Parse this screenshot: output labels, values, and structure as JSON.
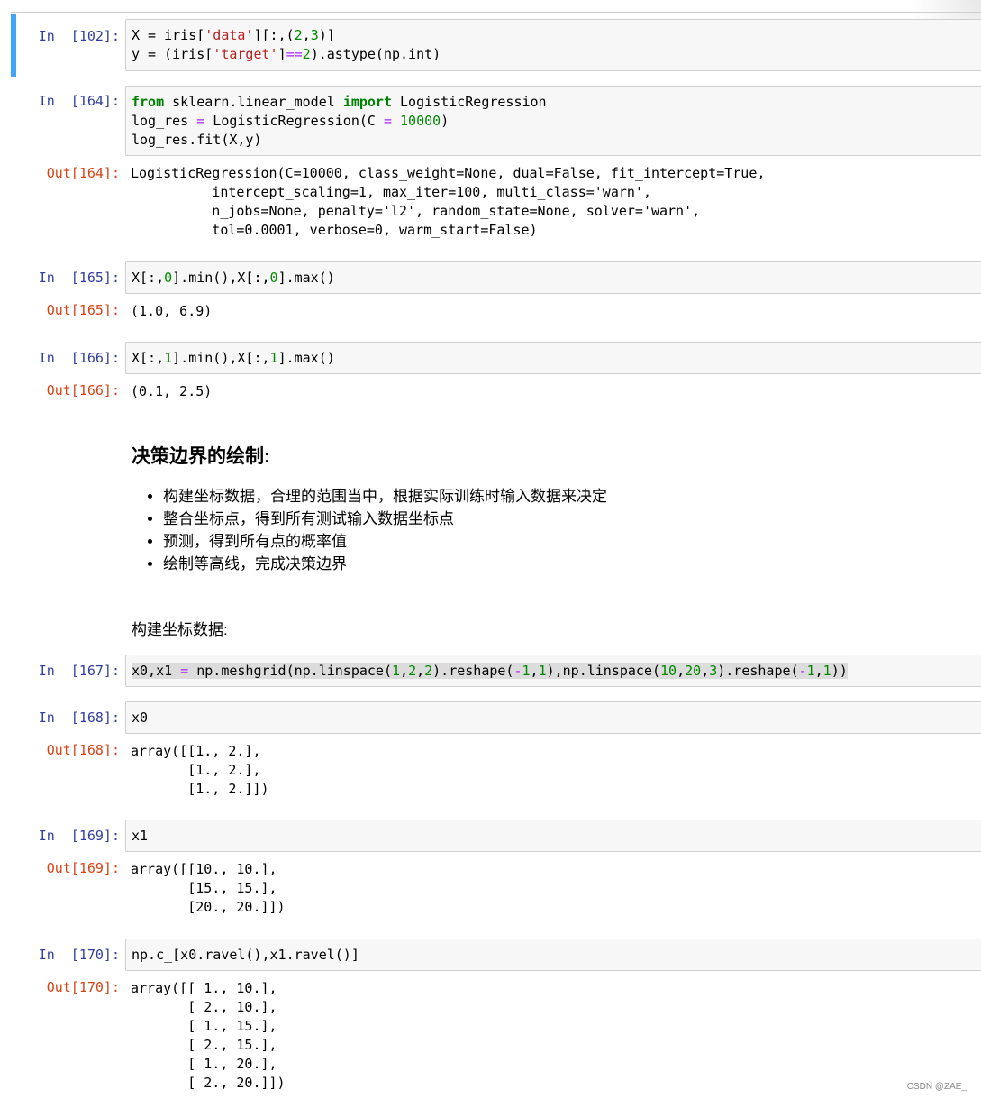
{
  "cells": [
    {
      "id": "c102",
      "in": "In  [102]:",
      "code": [
        "X = iris['data'][:,(2,3)]",
        "y = (iris['target']==2).astype(np.int)"
      ]
    },
    {
      "id": "c164",
      "in": "In  [164]:",
      "code": [
        "from sklearn.linear_model import LogisticRegression",
        "log_res = LogisticRegression(C = 10000)",
        "log_res.fit(X,y)"
      ],
      "out": "Out[164]:",
      "output": [
        "LogisticRegression(C=10000, class_weight=None, dual=False, fit_intercept=True,",
        "          intercept_scaling=1, max_iter=100, multi_class='warn',",
        "          n_jobs=None, penalty='l2', random_state=None, solver='warn',",
        "          tol=0.0001, verbose=0, warm_start=False)"
      ]
    },
    {
      "id": "c165",
      "in": "In  [165]:",
      "code": [
        "X[:,0].min(),X[:,0].max()"
      ],
      "out": "Out[165]:",
      "output": [
        "(1.0, 6.9)"
      ]
    },
    {
      "id": "c166",
      "in": "In  [166]:",
      "code": [
        "X[:,1].min(),X[:,1].max()"
      ],
      "out": "Out[166]:",
      "output": [
        "(0.1, 2.5)"
      ]
    },
    {
      "id": "c167",
      "in": "In  [167]:",
      "code": [
        "x0,x1 = np.meshgrid(np.linspace(1,2,2).reshape(-1,1),np.linspace(10,20,3).reshape(-1,1))"
      ]
    },
    {
      "id": "c168",
      "in": "In  [168]:",
      "code": [
        "x0"
      ],
      "out": "Out[168]:",
      "output": [
        "array([[1., 2.],",
        "       [1., 2.],",
        "       [1., 2.]])"
      ]
    },
    {
      "id": "c169",
      "in": "In  [169]:",
      "code": [
        "x1"
      ],
      "out": "Out[169]:",
      "output": [
        "array([[10., 10.],",
        "       [15., 15.],",
        "       [20., 20.]])"
      ]
    },
    {
      "id": "c170",
      "in": "In  [170]:",
      "code": [
        "np.c_[x0.ravel(),x1.ravel()]"
      ],
      "out": "Out[170]:",
      "output": [
        "array([[ 1., 10.],",
        "       [ 2., 10.],",
        "       [ 1., 15.],",
        "       [ 2., 15.],",
        "       [ 1., 20.],",
        "       [ 2., 20.]])"
      ]
    }
  ],
  "markdown": {
    "heading": "决策边界的绘制:",
    "bullets": [
      "构建坐标数据，合理的范围当中，根据实际训练时输入数据来决定",
      "整合坐标点，得到所有测试输入数据坐标点",
      "预测，得到所有点的概率值",
      "绘制等高线，完成决策边界"
    ],
    "paragraph": "构建坐标数据:"
  },
  "watermark": "CSDN @ZAE_"
}
